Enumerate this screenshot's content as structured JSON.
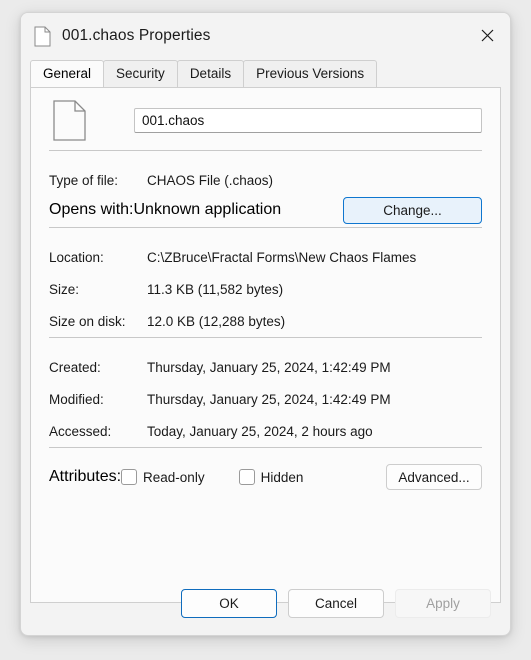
{
  "window": {
    "title": "001.chaos Properties",
    "title_icon": "file-document-icon",
    "close_label": "✕"
  },
  "tabs": [
    {
      "label": "General",
      "active": true
    },
    {
      "label": "Security",
      "active": false
    },
    {
      "label": "Details",
      "active": false
    },
    {
      "label": "Previous Versions",
      "active": false
    }
  ],
  "general": {
    "file_icon": "file-document-icon",
    "filename": "001.chaos",
    "filename_placeholder": "File name",
    "fields_type": [
      {
        "label": "Type of file:",
        "value": "CHAOS File (.chaos)"
      }
    ],
    "opens_with": {
      "label": "Opens with:",
      "value": "Unknown application",
      "button": "Change..."
    },
    "fields_location": [
      {
        "label": "Location:",
        "value": "C:\\ZBruce\\Fractal Forms\\New Chaos Flames"
      },
      {
        "label": "Size:",
        "value": "11.3 KB (11,582 bytes)"
      },
      {
        "label": "Size on disk:",
        "value": "12.0 KB (12,288 bytes)"
      }
    ],
    "fields_dates": [
      {
        "label": "Created:",
        "value": "Thursday, January 25, 2024, 1:42:49 PM"
      },
      {
        "label": "Modified:",
        "value": "Thursday, January 25, 2024, 1:42:49 PM"
      },
      {
        "label": "Accessed:",
        "value": "Today, January 25, 2024, 2 hours ago"
      }
    ],
    "attributes": {
      "label": "Attributes:",
      "readonly_label": "Read-only",
      "readonly_checked": false,
      "hidden_label": "Hidden",
      "hidden_checked": false,
      "advanced_button": "Advanced..."
    }
  },
  "footer": {
    "ok": "OK",
    "cancel": "Cancel",
    "apply": "Apply",
    "apply_disabled": true
  },
  "colors": {
    "accent": "#0f6cbd",
    "highlight_fill": "#e8f2fb",
    "page_background": "#ebebeb",
    "dialog_background": "#f3f3f3",
    "panel_background": "#fbfbfb"
  }
}
